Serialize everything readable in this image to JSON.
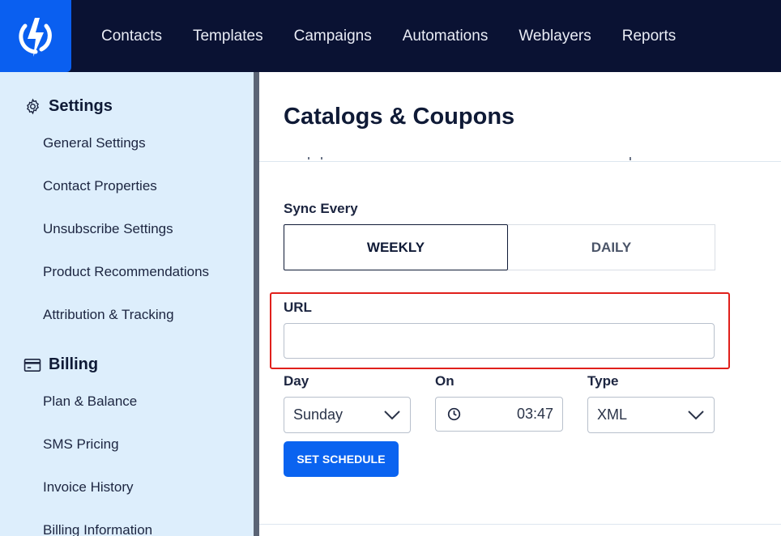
{
  "nav": {
    "items": [
      "Contacts",
      "Templates",
      "Campaigns",
      "Automations",
      "Weblayers",
      "Reports"
    ]
  },
  "sidebar": {
    "settings_title": "Settings",
    "settings_items": [
      "General Settings",
      "Contact Properties",
      "Unsubscribe Settings",
      "Product Recommendations",
      "Attribution & Tracking"
    ],
    "billing_title": "Billing",
    "billing_items": [
      "Plan & Balance",
      "SMS Pricing",
      "Invoice History",
      "Billing Information"
    ]
  },
  "main": {
    "title": "Catalogs & Coupons",
    "sync_label": "Sync Every",
    "sync_options": [
      "WEEKLY",
      "DAILY"
    ],
    "sync_selected": "WEEKLY",
    "url_label": "URL",
    "url_value": "",
    "day_label": "Day",
    "day_value": "Sunday",
    "on_label": "On",
    "on_value": "03:47",
    "type_label": "Type",
    "type_value": "XML",
    "set_schedule_label": "SET SCHEDULE"
  },
  "colors": {
    "nav_bg": "#0a1233",
    "brand_blue": "#0a5ff0",
    "sidebar_bg": "#ddeefc",
    "highlight": "#e0201b"
  },
  "icons": {
    "logo": "lightning-bolt-logo",
    "settings": "gear-icon",
    "billing": "credit-card-icon",
    "time": "clock-icon",
    "select": "chevron-down-icon"
  }
}
